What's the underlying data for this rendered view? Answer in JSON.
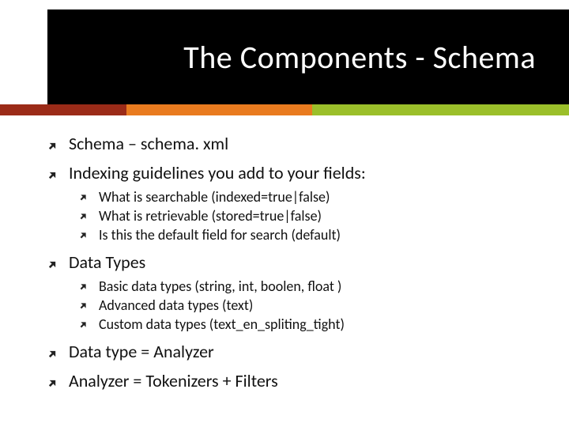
{
  "title": "The Components - Schema",
  "bullets": [
    {
      "text": "Schema – schema. xml",
      "children": []
    },
    {
      "text": "Indexing guidelines you add to your fields:",
      "children": [
        "What is searchable (indexed=true|false)",
        "What is retrievable (stored=true|false)",
        "Is this the default field for search (default)"
      ]
    },
    {
      "text": "Data Types",
      "children": [
        "Basic data types (string, int, boolen, float )",
        "Advanced data types (text)",
        "Custom data types (text_en_spliting_tight)"
      ]
    },
    {
      "text": "Data type = Analyzer",
      "children": []
    },
    {
      "text": "Analyzer = Tokenizers + Filters",
      "children": []
    }
  ]
}
